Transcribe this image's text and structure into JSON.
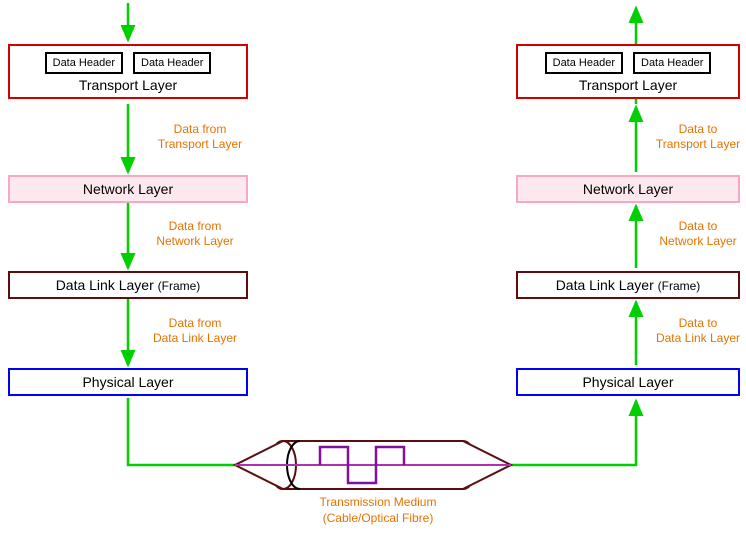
{
  "left": {
    "transport": {
      "header1": "Data Header",
      "header2": "Data Header",
      "title": "Transport Layer",
      "arrow": "Data from\nTransport Layer"
    },
    "network": {
      "title": "Network Layer",
      "arrow": "Data from\nNetwork Layer"
    },
    "datalink": {
      "title": "Data Link Layer",
      "frame": "(Frame)",
      "arrow": "Data from\nData Link Layer"
    },
    "physical": {
      "title": "Physical Layer"
    }
  },
  "right": {
    "transport": {
      "header1": "Data Header",
      "header2": "Data Header",
      "title": "Transport Layer",
      "arrow": "Data to\nTransport Layer"
    },
    "network": {
      "title": "Network Layer",
      "arrow": "Data to\nNetwork Layer"
    },
    "datalink": {
      "title": "Data Link Layer",
      "frame": "(Frame)",
      "arrow": "Data to\nData Link Layer"
    },
    "physical": {
      "title": "Physical Layer"
    }
  },
  "medium": {
    "line1": "Transmission Medium",
    "line2": "(Cable/Optical Fibre)"
  }
}
